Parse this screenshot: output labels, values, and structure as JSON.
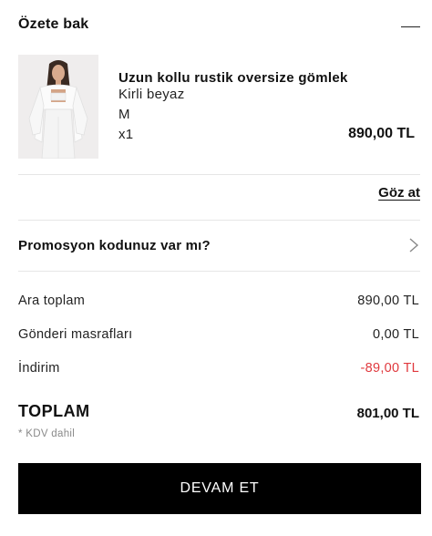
{
  "summary": {
    "title": "Özete bak"
  },
  "product": {
    "name": "Uzun kollu rustik oversize gömlek",
    "color": "Kirli beyaz",
    "size": "M",
    "quantity": "x1",
    "price": "890,00 TL"
  },
  "view_link": "Göz at",
  "promo": {
    "label": "Promosyon kodunuz var mı?",
    "icon": "chevron-right-icon"
  },
  "totals": {
    "rows": [
      {
        "label": "Ara toplam",
        "value": "890,00 TL"
      },
      {
        "label": "Gönderi masrafları",
        "value": "0,00 TL"
      },
      {
        "label": "İndirim",
        "value": "-89,00 TL"
      }
    ],
    "total_label": "TOPLAM",
    "total_value": "801,00 TL",
    "tax_note": "* KDV dahil"
  },
  "cta": {
    "label": "DEVAM ET"
  },
  "colors": {
    "button_bg": "#000000",
    "discount": "#e0393e",
    "divider": "#e6e6e6"
  }
}
